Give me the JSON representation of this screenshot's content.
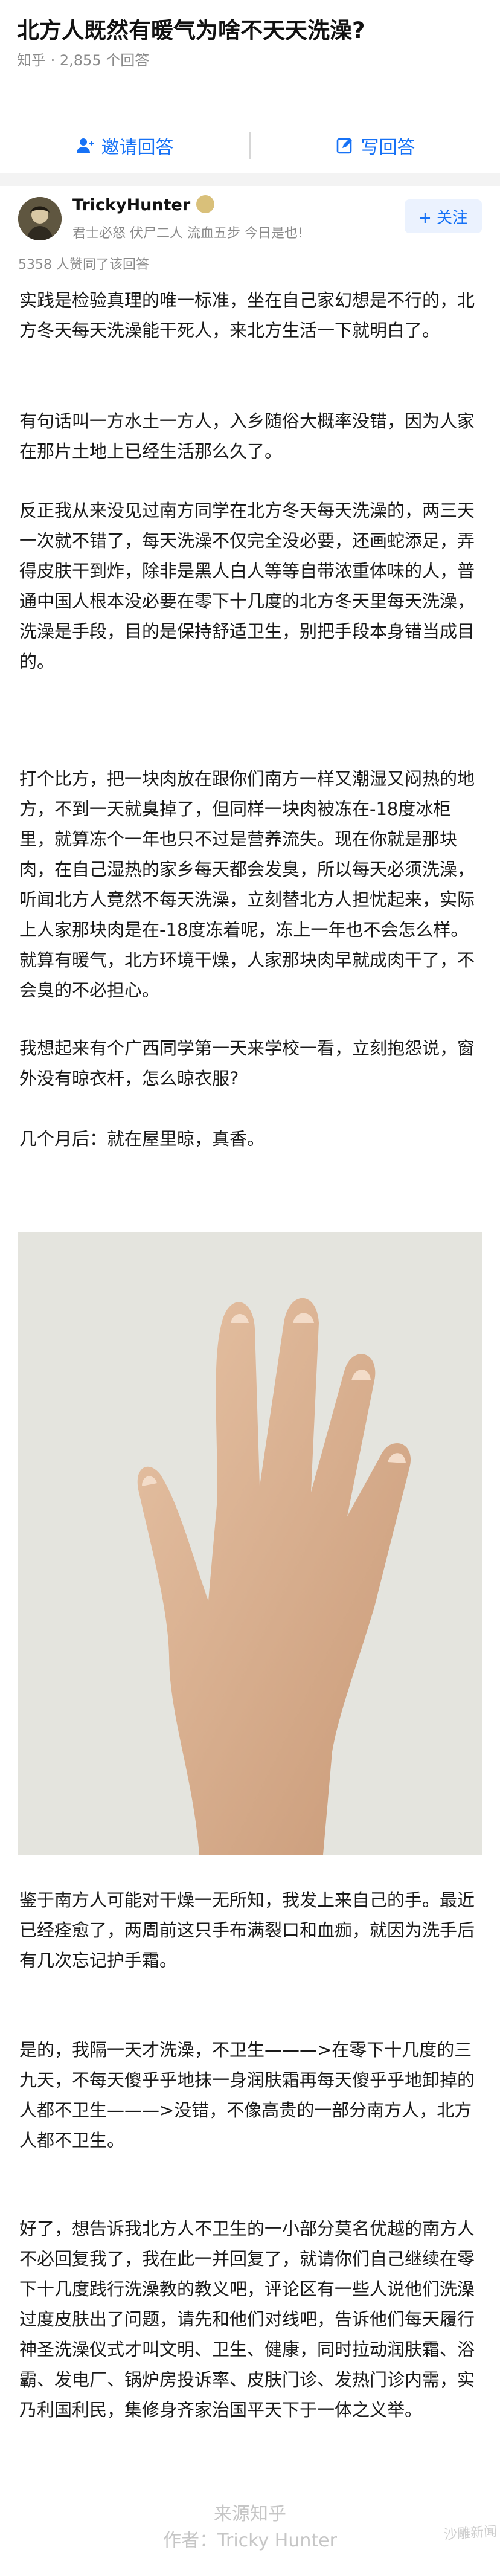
{
  "question": {
    "title": "北方人既然有暖气为啥不天天洗澡?",
    "meta": "知乎 · 2,855 个回答"
  },
  "actions": {
    "invite": "邀请回答",
    "write": "写回答"
  },
  "answer": {
    "author_name": "TrickyHunter",
    "author_bio": "君士必怒 伏尸二人 流血五步 今日是也!",
    "follow_label": "+ 关注",
    "upvotes": "5358 人赞同了该回答",
    "paragraphs": [
      "实践是检验真理的唯一标准，坐在自己家幻想是不行的，北方冬天每天洗澡能干死人，来北方生活一下就明白了。",
      "有句话叫一方水土一方人，入乡随俗大概率没错，因为人家在那片土地上已经生活那么久了。",
      "反正我从来没见过南方同学在北方冬天每天洗澡的，两三天一次就不错了，每天洗澡不仅完全没必要，还画蛇添足，弄得皮肤干到炸，除非是黑人白人等等自带浓重体味的人，普通中国人根本没必要在零下十几度的北方冬天里每天洗澡，洗澡是手段，目的是保持舒适卫生，别把手段本身错当成目的。",
      "打个比方，把一块肉放在跟你们南方一样又潮湿又闷热的地方，不到一天就臭掉了，但同样一块肉被冻在-18度冰柜里，就算冻个一年也只不过是营养流失。现在你就是那块肉，在自己湿热的家乡每天都会发臭，所以每天必须洗澡，听闻北方人竟然不每天洗澡，立刻替北方人担忧起来，实际上人家那块肉是在-18度冻着呢，冻上一年也不会怎么样。就算有暖气，北方环境干燥，人家那块肉早就成肉干了，不会臭的不必担心。",
      "我想起来有个广西同学第一天来学校一看，立刻抱怨说，窗外没有晾衣杆，怎么晾衣服?",
      "几个月后：就在屋里晾，真香。",
      "鉴于南方人可能对干燥一无所知，我发上来自己的手。最近已经痊愈了，两周前这只手布满裂口和血痂，就因为洗手后有几次忘记护手霜。",
      "是的，我隔一天才洗澡，不卫生———>在零下十几度的三九天，不每天傻乎乎地抹一身润肤霜再每天傻乎乎地卸掉的人都不卫生———>没错，不像高贵的一部分南方人，北方人都不卫生。",
      "好了，想告诉我北方人不卫生的一小部分莫名优越的南方人不必回复我了，我在此一并回复了，就请你们自己继续在零下十几度践行洗澡教的教义吧，评论区有一些人说他们洗澡过度皮肤出了问题，请先和他们对线吧，告诉他们每天履行神圣洗澡仪式才叫文明、卫生、健康，同时拉动润肤霜、浴霸、发电厂、锅炉房投诉率、皮肤门诊、发热门诊内需，实乃利国利民，集修身齐家治国平天下于一体之义举。"
    ]
  },
  "watermark": {
    "line1": "来源知乎",
    "line2": "作者：Tricky Hunter",
    "corner": "沙雕新闻"
  },
  "colors": {
    "accent": "#1772f6",
    "muted": "#8a8a8a",
    "follow_bg": "#ebf2fe"
  },
  "icons": {
    "invite": "invite-user-icon",
    "write": "pencil-edit-icon",
    "badge": "medal-badge-icon"
  }
}
